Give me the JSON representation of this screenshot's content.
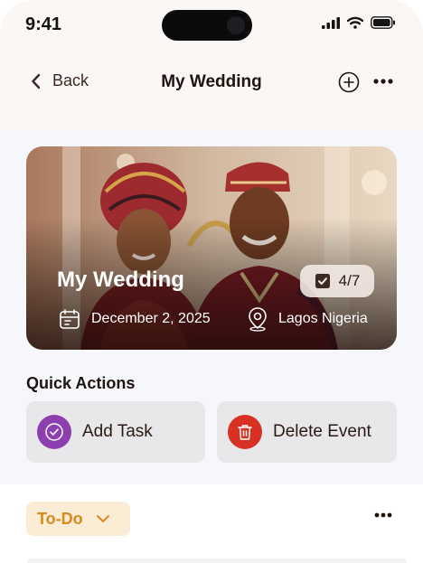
{
  "status_bar": {
    "time": "9:41"
  },
  "nav": {
    "back_label": "Back",
    "title": "My Wedding"
  },
  "hero": {
    "title": "My Wedding",
    "tasks_progress": "4/7",
    "date": "December 2, 2025",
    "location": "Lagos Nigeria"
  },
  "quick_actions": {
    "title": "Quick Actions",
    "add_task_label": "Add Task",
    "delete_event_label": "Delete Event"
  },
  "list": {
    "filter_label": "To-Do"
  },
  "colors": {
    "accent_orange": "#d98a1e",
    "chip_bg": "#fbecd6",
    "add_task_icon": "#8d3fb0",
    "delete_icon": "#d63122"
  },
  "icons": [
    "chevron-left-icon",
    "plus-circle-icon",
    "more-icon",
    "checkbox-icon",
    "calendar-icon",
    "location-pin-icon",
    "check-circle-icon",
    "trash-icon",
    "chevron-down-icon"
  ]
}
